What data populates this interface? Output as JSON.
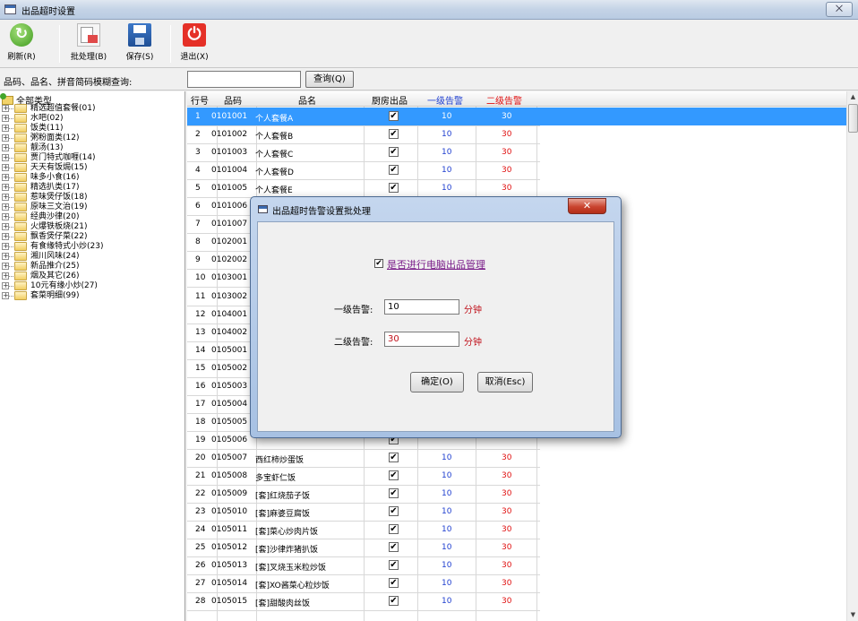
{
  "window": {
    "title": "出品超时设置",
    "close_label": "⨉"
  },
  "toolbar": {
    "buttons": [
      {
        "label": "刷新(R)",
        "icon": "refresh-icon"
      },
      {
        "label": "批处理(B)",
        "icon": "batch-icon"
      },
      {
        "label": "保存(S)",
        "icon": "save-icon"
      },
      {
        "label": "退出(X)",
        "icon": "power-icon"
      }
    ]
  },
  "search": {
    "label": "品码、品名、拼音简码模糊查询:",
    "value": "",
    "button": "查询(Q)"
  },
  "tree": {
    "root": "全部类型",
    "items": [
      "精选超值套餐(01)",
      "水吧(02)",
      "饭类(11)",
      "粥粉面类(12)",
      "靓汤(13)",
      "贾门特式咖喱(14)",
      "天天有饭焗(15)",
      "味多小食(16)",
      "精选扒类(17)",
      "惹味煲仔饭(18)",
      "原味三文治(19)",
      "经典沙律(20)",
      "火爆铁板烧(21)",
      "飘香煲仔菜(22)",
      "有食缘特式小炒(23)",
      "湘川风味(24)",
      "新品推介(25)",
      "烟及其它(26)",
      "10元有缘小炒(27)",
      "套菜明细(99)"
    ]
  },
  "grid": {
    "headers": {
      "row": "行号",
      "code": "品码",
      "name": "品名",
      "kitchen": "厨房出品",
      "level1": "一级告警",
      "level2": "二级告警"
    },
    "rows": [
      {
        "no": "1",
        "code": "0101001",
        "name": "个人套餐A",
        "level1": "10",
        "level2": "30"
      },
      {
        "no": "2",
        "code": "0101002",
        "name": "个人套餐B",
        "level1": "10",
        "level2": "30"
      },
      {
        "no": "3",
        "code": "0101003",
        "name": "个人套餐C",
        "level1": "10",
        "level2": "30"
      },
      {
        "no": "4",
        "code": "0101004",
        "name": "个人套餐D",
        "level1": "10",
        "level2": "30"
      },
      {
        "no": "5",
        "code": "0101005",
        "name": "个人套餐E",
        "level1": "10",
        "level2": "30"
      },
      {
        "no": "6",
        "code": "0101006",
        "name": "",
        "level1": "",
        "level2": ""
      },
      {
        "no": "7",
        "code": "0101007",
        "name": "",
        "level1": "",
        "level2": ""
      },
      {
        "no": "8",
        "code": "0102001",
        "name": "",
        "level1": "",
        "level2": ""
      },
      {
        "no": "9",
        "code": "0102002",
        "name": "",
        "level1": "",
        "level2": ""
      },
      {
        "no": "10",
        "code": "0103001",
        "name": "",
        "level1": "",
        "level2": ""
      },
      {
        "no": "11",
        "code": "0103002",
        "name": "",
        "level1": "",
        "level2": ""
      },
      {
        "no": "12",
        "code": "0104001",
        "name": "",
        "level1": "",
        "level2": ""
      },
      {
        "no": "13",
        "code": "0104002",
        "name": "",
        "level1": "",
        "level2": ""
      },
      {
        "no": "14",
        "code": "0105001",
        "name": "",
        "level1": "",
        "level2": ""
      },
      {
        "no": "15",
        "code": "0105002",
        "name": "",
        "level1": "",
        "level2": ""
      },
      {
        "no": "16",
        "code": "0105003",
        "name": "",
        "level1": "",
        "level2": ""
      },
      {
        "no": "17",
        "code": "0105004",
        "name": "",
        "level1": "",
        "level2": ""
      },
      {
        "no": "18",
        "code": "0105005",
        "name": "",
        "level1": "",
        "level2": ""
      },
      {
        "no": "19",
        "code": "0105006",
        "name": "",
        "level1": "",
        "level2": ""
      },
      {
        "no": "20",
        "code": "0105007",
        "name": "西红柿炒蛋饭",
        "level1": "10",
        "level2": "30"
      },
      {
        "no": "21",
        "code": "0105008",
        "name": "多宝虾仁饭",
        "level1": "10",
        "level2": "30"
      },
      {
        "no": "22",
        "code": "0105009",
        "name": "[套]红烧茄子饭",
        "level1": "10",
        "level2": "30"
      },
      {
        "no": "23",
        "code": "0105010",
        "name": "[套]麻婆豆腐饭",
        "level1": "10",
        "level2": "30"
      },
      {
        "no": "24",
        "code": "0105011",
        "name": "[套]菜心炒肉片饭",
        "level1": "10",
        "level2": "30"
      },
      {
        "no": "25",
        "code": "0105012",
        "name": "[套]沙律炸猪扒饭",
        "level1": "10",
        "level2": "30"
      },
      {
        "no": "26",
        "code": "0105013",
        "name": "[套]叉烧玉米粒炒饭",
        "level1": "10",
        "level2": "30"
      },
      {
        "no": "27",
        "code": "0105014",
        "name": "[套]XO酱菜心粒炒饭",
        "level1": "10",
        "level2": "30"
      },
      {
        "no": "28",
        "code": "0105015",
        "name": "[套]甜酸肉丝饭",
        "level1": "10",
        "level2": "30"
      }
    ],
    "checkmark": "✔"
  },
  "dialog": {
    "title": "出品超时告警设置批处理",
    "close_label": "✕",
    "enable_label": "是否进行电脑出品管理",
    "enable_check": "✔",
    "level1_label": "一级告警:",
    "level1_value": "10",
    "level2_label": "二级告警:",
    "level2_value": "30",
    "unit": "分钟",
    "ok_button": "确定(O)",
    "cancel_button": "取消(Esc)"
  }
}
